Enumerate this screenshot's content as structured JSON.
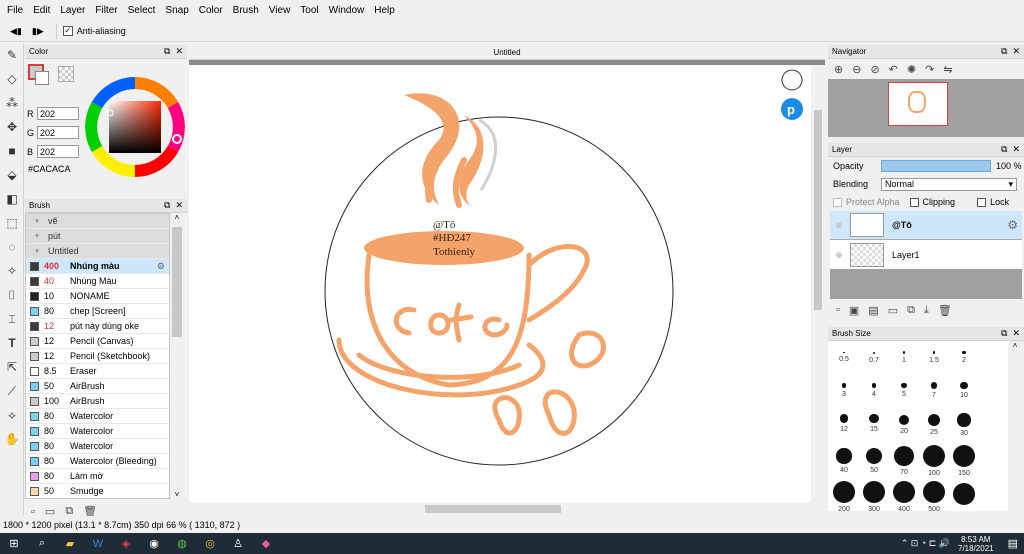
{
  "menu": [
    "File",
    "Edit",
    "Layer",
    "Filter",
    "Select",
    "Snap",
    "Color",
    "Brush",
    "View",
    "Tool",
    "Window",
    "Help"
  ],
  "tool_options": {
    "antialias_label": "Anti-aliasing",
    "checked": true
  },
  "color_panel": {
    "title": "Color",
    "r": "202",
    "g": "202",
    "b": "202",
    "r_label": "R",
    "g_label": "G",
    "b_label": "B",
    "hex": "#CACACA"
  },
  "brush_panel": {
    "title": "Brush",
    "groups": [
      "vẽ",
      "pút",
      "Untitled"
    ],
    "items": [
      {
        "size": "400",
        "name": "Nhúng màu",
        "color": "#3a3a3a",
        "selected": true,
        "sizecolor": "#e03030",
        "bold": true
      },
      {
        "size": "40",
        "name": "Nhúng Màu",
        "color": "#3a3a3a",
        "sizecolor": "#e03030"
      },
      {
        "size": "10",
        "name": "NONAME",
        "color": "#222222",
        "sizecolor": "#000"
      },
      {
        "size": "80",
        "name": "chep [Screen]",
        "color": "#7fd0f0",
        "sizecolor": "#000"
      },
      {
        "size": "12",
        "name": "pút này dùng oke",
        "color": "#3a3a3a",
        "sizecolor": "#e03030"
      },
      {
        "size": "12",
        "name": "Pencil (Canvas)",
        "color": "#cccccc",
        "sizecolor": "#000"
      },
      {
        "size": "12",
        "name": "Pencil (Sketchbook)",
        "color": "#cccccc",
        "sizecolor": "#000"
      },
      {
        "size": "8.5",
        "name": "Eraser",
        "color": "#ffffff",
        "sizecolor": "#000"
      },
      {
        "size": "50",
        "name": "AirBrush",
        "color": "#7fd0f0",
        "sizecolor": "#000"
      },
      {
        "size": "100",
        "name": "AirBrush",
        "color": "#cccccc",
        "sizecolor": "#000"
      },
      {
        "size": "80",
        "name": "Watercolor",
        "color": "#7fd0f0",
        "sizecolor": "#000"
      },
      {
        "size": "80",
        "name": "Watercolor",
        "color": "#7fd0f0",
        "sizecolor": "#000"
      },
      {
        "size": "80",
        "name": "Watercolor",
        "color": "#7fd0f0",
        "sizecolor": "#000"
      },
      {
        "size": "80",
        "name": "Watercolor (Bleeding)",
        "color": "#7fd0f0",
        "sizecolor": "#000"
      },
      {
        "size": "80",
        "name": "Làm mờ",
        "color": "#e8a0e8",
        "sizecolor": "#000"
      },
      {
        "size": "50",
        "name": "Smudge",
        "color": "#f8d8b0",
        "sizecolor": "#000"
      }
    ]
  },
  "canvas": {
    "tab_title": "Untitled",
    "text_line1": "@Tô",
    "text_line2": "#HĐ247",
    "text_line3": "Tothienly",
    "logo_text": "cofe"
  },
  "navigator": {
    "title": "Navigator"
  },
  "layer_panel": {
    "title": "Layer",
    "opacity_label": "Opacity",
    "opacity_value": "100 %",
    "blending_label": "Blending",
    "blending_value": "Normal",
    "protect_alpha": "Protect Alpha",
    "clipping": "Clipping",
    "lock": "Lock",
    "layers": [
      {
        "name": "@Tô",
        "selected": true
      },
      {
        "name": "Layer1",
        "selected": false
      }
    ]
  },
  "brush_size": {
    "title": "Brush Size",
    "sizes": [
      "0.5",
      "0.7",
      "1",
      "1.5",
      "2",
      "3",
      "4",
      "5",
      "7",
      "10",
      "12",
      "15",
      "20",
      "25",
      "30",
      "40",
      "50",
      "70",
      "100",
      "150",
      "200",
      "300",
      "400",
      "500"
    ]
  },
  "status": {
    "text": "1800 * 1200 pixel  (13.1 * 8.7cm)  350 dpi  66 %  ( 1310, 872 )"
  },
  "taskbar": {
    "time": "8:53 AM",
    "date": "7/18/2021"
  },
  "colors": {
    "accent": "#f4a46a",
    "selected_row": "#cfe7fb"
  }
}
